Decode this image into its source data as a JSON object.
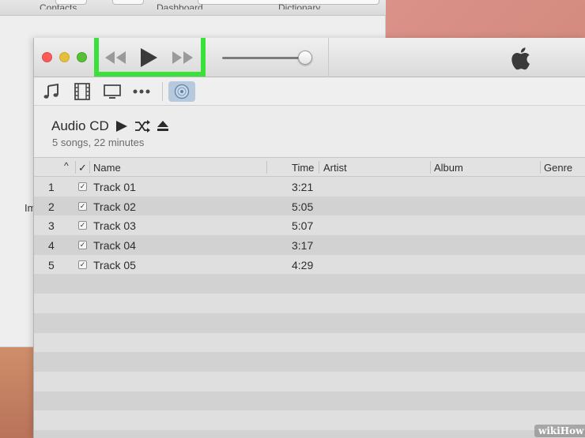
{
  "background_window": {
    "tabs": [
      "Contacts",
      "Dashboard",
      "Dictionary"
    ],
    "side_text": "Im"
  },
  "titlebar": {
    "controls": [
      "close",
      "minimize",
      "zoom"
    ],
    "transport": {
      "rewind_icon": "rewind-icon",
      "play_icon": "play-icon",
      "fast_forward_icon": "fast-forward-icon",
      "highlight_color": "#3be03b"
    },
    "volume_level": 1.0,
    "logo": "apple-logo"
  },
  "media_bar": {
    "icons": [
      "music-note-icon",
      "film-icon",
      "tv-icon",
      "more-icon",
      "cd-icon"
    ],
    "selected": "cd-icon"
  },
  "header": {
    "title": "Audio CD",
    "subtitle": "5 songs, 22 minutes"
  },
  "table": {
    "columns": {
      "sort": "^",
      "check": "✓",
      "name": "Name",
      "time": "Time",
      "artist": "Artist",
      "album": "Album",
      "genre": "Genre"
    },
    "rows": [
      {
        "num": "1",
        "name": "Track 01",
        "time": "3:21",
        "checked": true
      },
      {
        "num": "2",
        "name": "Track 02",
        "time": "5:05",
        "checked": true
      },
      {
        "num": "3",
        "name": "Track 03",
        "time": "5:07",
        "checked": true
      },
      {
        "num": "4",
        "name": "Track 04",
        "time": "3:17",
        "checked": true
      },
      {
        "num": "5",
        "name": "Track 05",
        "time": "4:29",
        "checked": true
      }
    ]
  },
  "watermark": {
    "wiki": "wiki",
    "how": "How"
  }
}
